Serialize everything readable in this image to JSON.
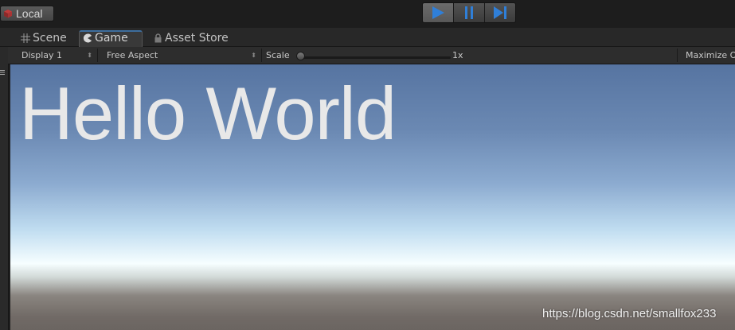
{
  "toolbar": {
    "local_label": "Local",
    "play_icon": "play-icon",
    "pause_icon": "pause-icon",
    "step_icon": "step-icon",
    "accent_color": "#2f7fd8"
  },
  "tabs": [
    {
      "label": "Scene",
      "icon": "grid-icon",
      "active": false
    },
    {
      "label": "Game",
      "icon": "pacman-icon",
      "active": true
    },
    {
      "label": "Asset Store",
      "icon": "lock-icon",
      "active": false
    }
  ],
  "controls": {
    "display": "Display 1",
    "aspect": "Free Aspect",
    "scale_label": "Scale",
    "scale_value": "1x",
    "maximize_label": "Maximize On Play"
  },
  "game": {
    "hello_text": "Hello World"
  },
  "watermark": "https://blog.csdn.net/smallfox233"
}
